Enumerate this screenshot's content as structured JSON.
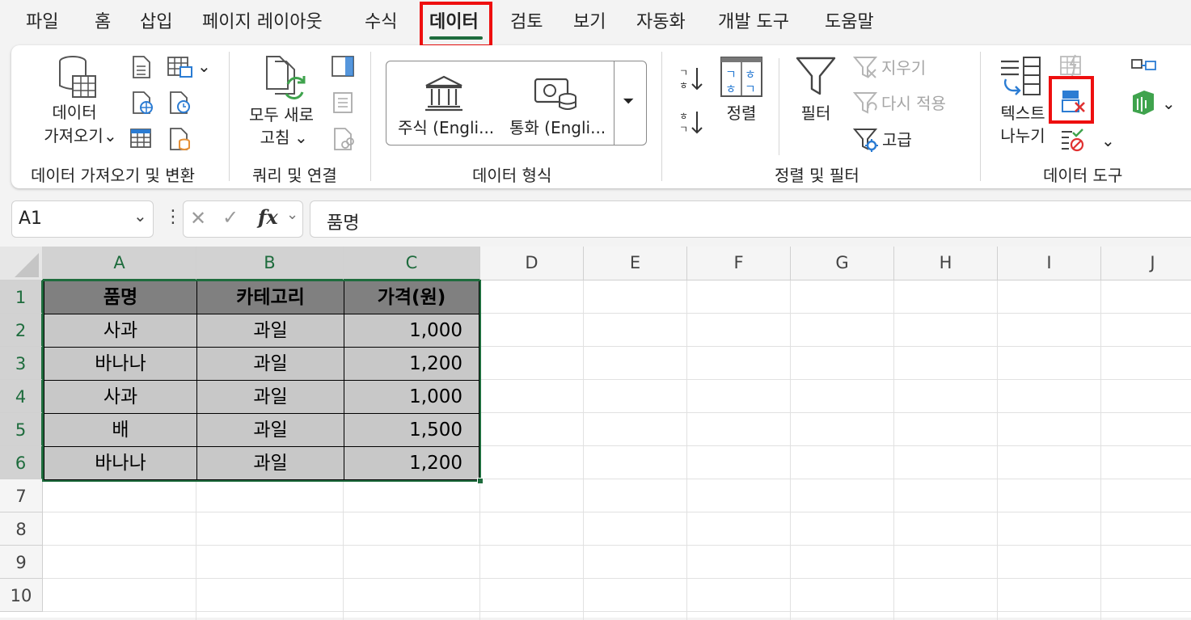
{
  "tabs": [
    "파일",
    "홈",
    "삽입",
    "페이지 레이아웃",
    "수식",
    "데이터",
    "검토",
    "보기",
    "자동화",
    "개발 도구",
    "도움말"
  ],
  "active_tab": "데이터",
  "ribbon": {
    "get_data": {
      "label_line1": "데이터",
      "label_line2": "가져오기"
    },
    "refresh_all": {
      "label_line1": "모두 새로",
      "label_line2": "고침"
    },
    "stocks": {
      "label": "주식 (Engli..."
    },
    "currencies": {
      "label": "통화 (Engli..."
    },
    "sort": {
      "label": "정렬"
    },
    "filter": {
      "label": "필터"
    },
    "clear": {
      "label": "지우기"
    },
    "reapply": {
      "label": "다시 적용"
    },
    "advanced": {
      "label": "고급"
    },
    "text_to_columns": {
      "label_line1": "텍스트",
      "label_line2": "나누기"
    },
    "groups": [
      "데이터 가져오기 및 변환",
      "쿼리 및 연결",
      "데이터 형식",
      "정렬 및 필터",
      "데이터 도구"
    ]
  },
  "formula_bar": {
    "name_box": "A1",
    "fx": "fx",
    "formula": "품명"
  },
  "sheet": {
    "columns": [
      "A",
      "B",
      "C",
      "D",
      "E",
      "F",
      "G",
      "H",
      "I",
      "J"
    ],
    "rows": [
      "1",
      "2",
      "3",
      "4",
      "5",
      "6",
      "7",
      "8",
      "9",
      "10"
    ],
    "table_header": [
      "품명",
      "카테고리",
      "가격(원)"
    ],
    "table_rows": [
      [
        "사과",
        "과일",
        "1,000"
      ],
      [
        "바나나",
        "과일",
        "1,200"
      ],
      [
        "사과",
        "과일",
        "1,000"
      ],
      [
        "배",
        "과일",
        "1,500"
      ],
      [
        "바나나",
        "과일",
        "1,200"
      ]
    ]
  },
  "colors": {
    "accent": "#1e6c3d",
    "highlight": "#ee0f0f",
    "header_fill": "#808080",
    "data_fill": "#c8c8c8"
  }
}
